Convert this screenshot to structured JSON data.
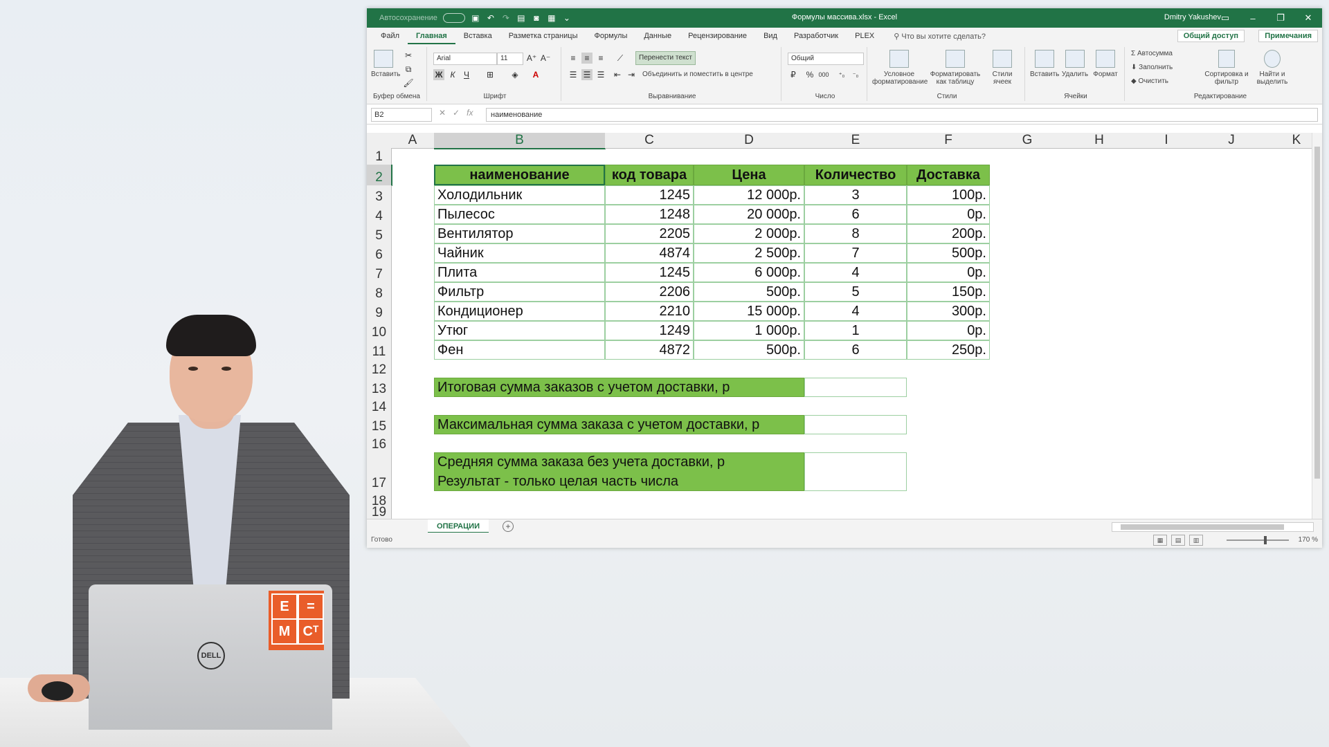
{
  "window": {
    "autosave_label": "Автосохранение",
    "title": "Формулы массива.xlsx  -  Excel",
    "user": "Dmitry Yakushev"
  },
  "tabs": [
    "Файл",
    "Главная",
    "Вставка",
    "Разметка страницы",
    "Формулы",
    "Данные",
    "Рецензирование",
    "Вид",
    "Разработчик",
    "PLEX"
  ],
  "active_tab": "Главная",
  "search_placeholder": "Что вы хотите сделать?",
  "share_label": "Общий доступ",
  "notes_label": "Примечания",
  "ribbon": {
    "clipboard": {
      "paste": "Вставить",
      "label": "Буфер обмена"
    },
    "font": {
      "name": "Arial",
      "size": "11",
      "bold": "Ж",
      "italic": "К",
      "underline": "Ч",
      "label": "Шрифт"
    },
    "alignment": {
      "wrap": "Перенести текст",
      "merge": "Объединить и поместить в центре",
      "label": "Выравнивание"
    },
    "number": {
      "format": "Общий",
      "label": "Число"
    },
    "styles": {
      "cond": "Условное форматирование",
      "table": "Форматировать как таблицу",
      "cell": "Стили ячеек",
      "label": "Стили"
    },
    "cells": {
      "insert": "Вставить",
      "delete": "Удалить",
      "format": "Формат",
      "label": "Ячейки"
    },
    "editing": {
      "autosum": "Автосумма",
      "fill": "Заполнить",
      "clear": "Очистить",
      "sort": "Сортировка и фильтр",
      "find": "Найти и выделить",
      "label": "Редактирование"
    }
  },
  "formula_bar": {
    "name_box": "B2",
    "value": "наименование"
  },
  "columns": [
    "A",
    "B",
    "C",
    "D",
    "E",
    "F",
    "G",
    "H",
    "I",
    "J",
    "K"
  ],
  "selected_column": "B",
  "rows": [
    "1",
    "2",
    "3",
    "4",
    "5",
    "6",
    "7",
    "8",
    "9",
    "10",
    "11",
    "12",
    "13",
    "14",
    "15",
    "16",
    "17",
    "18",
    "19"
  ],
  "selected_row": "2",
  "table": {
    "headers": [
      "наименование",
      "код товара",
      "Цена",
      "Количество",
      "Доставка"
    ],
    "rows": [
      [
        "Холодильник",
        "1245",
        "12 000р.",
        "3",
        "100р."
      ],
      [
        "Пылесос",
        "1248",
        "20 000р.",
        "6",
        "0р."
      ],
      [
        "Вентилятор",
        "2205",
        "2 000р.",
        "8",
        "200р."
      ],
      [
        "Чайник",
        "4874",
        "2 500р.",
        "7",
        "500р."
      ],
      [
        "Плита",
        "1245",
        "6 000р.",
        "4",
        "0р."
      ],
      [
        "Фильтр",
        "2206",
        "500р.",
        "5",
        "150р."
      ],
      [
        "Кондиционер",
        "2210",
        "15 000р.",
        "4",
        "300р."
      ],
      [
        "Утюг",
        "1249",
        "1 000р.",
        "1",
        "0р."
      ],
      [
        "Фен",
        "4872",
        "500р.",
        "6",
        "250р."
      ]
    ]
  },
  "summary": {
    "total": "Итоговая сумма заказов с учетом доставки, р",
    "max": "Максимальная сумма заказа с учетом доставки, р",
    "avg_line1": "Средняя сумма заказа без учета доставки, р",
    "avg_line2": "Результат - только целая часть числа"
  },
  "sheet_tab": "ОПЕРАЦИИ",
  "status": {
    "ready": "Готово",
    "zoom": "170 %"
  },
  "logo": {
    "tl": "E",
    "tr": "=",
    "bl": "M",
    "br": "Cᵀ",
    "laptop_brand": "DELL"
  },
  "colors": {
    "excel_green": "#217346",
    "header_fill": "#7cc04a"
  }
}
